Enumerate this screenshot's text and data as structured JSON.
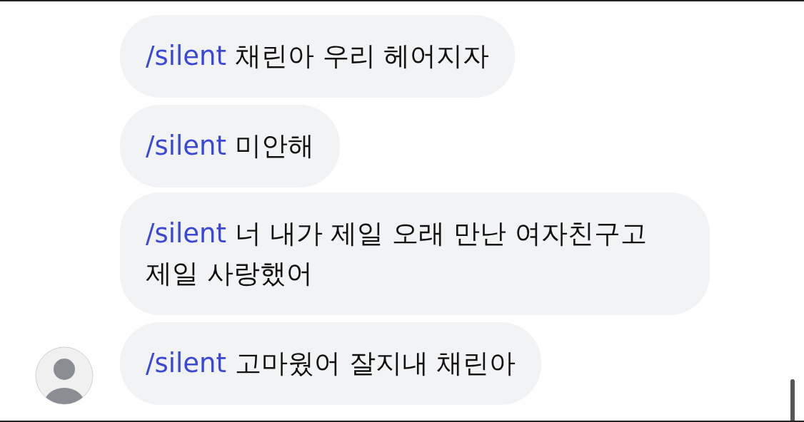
{
  "messages": [
    {
      "command": "/silent",
      "text": "채린아 우리 헤어지자",
      "show_avatar": false
    },
    {
      "command": "/silent",
      "text": "미안해",
      "show_avatar": false
    },
    {
      "command": "/silent",
      "text": "너 내가 제일 오래 만난 여자친구고 제일 사랑했어",
      "show_avatar": false
    },
    {
      "command": "/silent",
      "text": "고마웠어 잘지내 채린아",
      "show_avatar": true
    }
  ]
}
